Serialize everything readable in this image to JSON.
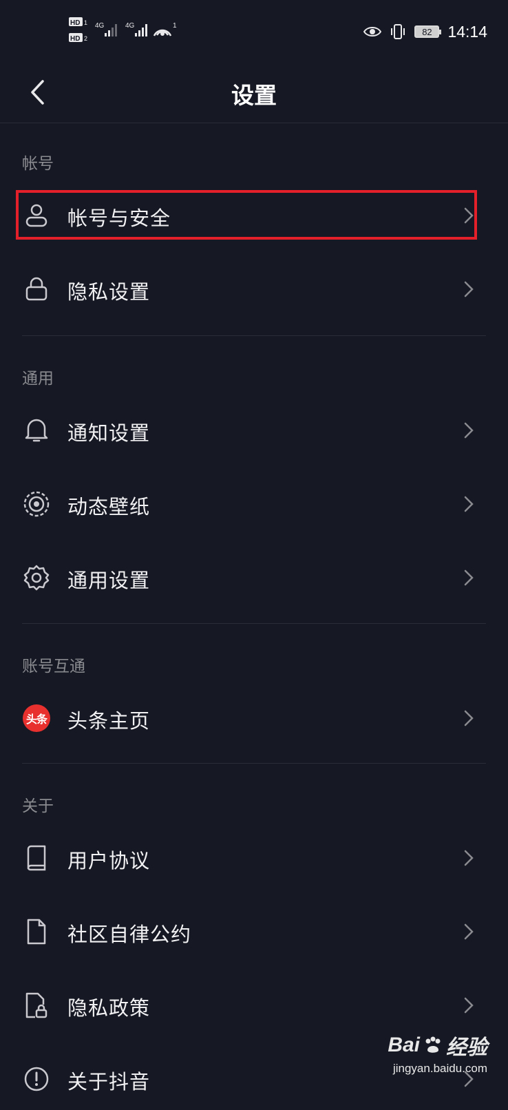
{
  "status_bar": {
    "time": "14:14",
    "battery": "82",
    "sim1": "HD",
    "sim2": "HD",
    "net1": "4G",
    "net2": "4G",
    "hotspot_count": "1"
  },
  "header": {
    "title": "设置",
    "back_icon": "chevron-left-icon"
  },
  "sections": {
    "account": {
      "label": "帐号",
      "items": [
        {
          "label": "帐号与安全",
          "icon": "person-icon",
          "highlighted": true
        },
        {
          "label": "隐私设置",
          "icon": "lock-icon"
        }
      ]
    },
    "general": {
      "label": "通用",
      "items": [
        {
          "label": "通知设置",
          "icon": "bell-icon"
        },
        {
          "label": "动态壁纸",
          "icon": "live-wallpaper-icon"
        },
        {
          "label": "通用设置",
          "icon": "gear-icon"
        }
      ]
    },
    "linked": {
      "label": "账号互通",
      "items": [
        {
          "label": "头条主页",
          "icon": "toutiao-logo-icon",
          "badge_text": "头条"
        }
      ]
    },
    "about": {
      "label": "关于",
      "items": [
        {
          "label": "用户协议",
          "icon": "book-icon"
        },
        {
          "label": "社区自律公约",
          "icon": "document-icon"
        },
        {
          "label": "隐私政策",
          "icon": "privacy-doc-icon"
        },
        {
          "label": "关于抖音",
          "icon": "info-icon"
        }
      ]
    }
  },
  "watermark": {
    "logo_text_1": "Bai",
    "logo_text_2": "经验",
    "url": "jingyan.baidu.com"
  },
  "colors": {
    "background": "#161823",
    "highlight_border": "#e4202a",
    "toutiao_red": "#e8312f"
  }
}
